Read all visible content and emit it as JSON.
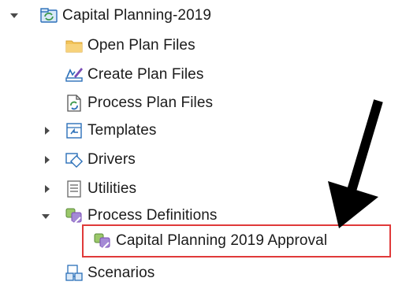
{
  "tree": {
    "root": {
      "label": "Capital Planning-2019",
      "expanded": true,
      "icon": "plan-folder-icon"
    },
    "items": [
      {
        "label": "Open Plan Files",
        "icon": "folder-icon"
      },
      {
        "label": "Create Plan Files",
        "icon": "create-file-icon"
      },
      {
        "label": "Process Plan Files",
        "icon": "process-file-icon"
      },
      {
        "label": "Templates",
        "icon": "templates-icon",
        "expanded": false
      },
      {
        "label": "Drivers",
        "icon": "drivers-icon",
        "expanded": false
      },
      {
        "label": "Utilities",
        "icon": "utilities-icon",
        "expanded": false
      },
      {
        "label": "Process Definitions",
        "icon": "process-definitions-icon",
        "expanded": true
      },
      {
        "label": "Capital Planning 2019 Approval",
        "icon": "process-definition-icon",
        "highlighted": true
      },
      {
        "label": "Scenarios",
        "icon": "scenarios-icon"
      }
    ]
  },
  "colors": {
    "highlight_border": "#e03a3a",
    "annotation_arrow": "#000000",
    "folder": "#f2c45a",
    "accent_blue": "#2a6fb8",
    "accent_green": "#3c9a4c",
    "accent_purple": "#7a4cb5"
  }
}
